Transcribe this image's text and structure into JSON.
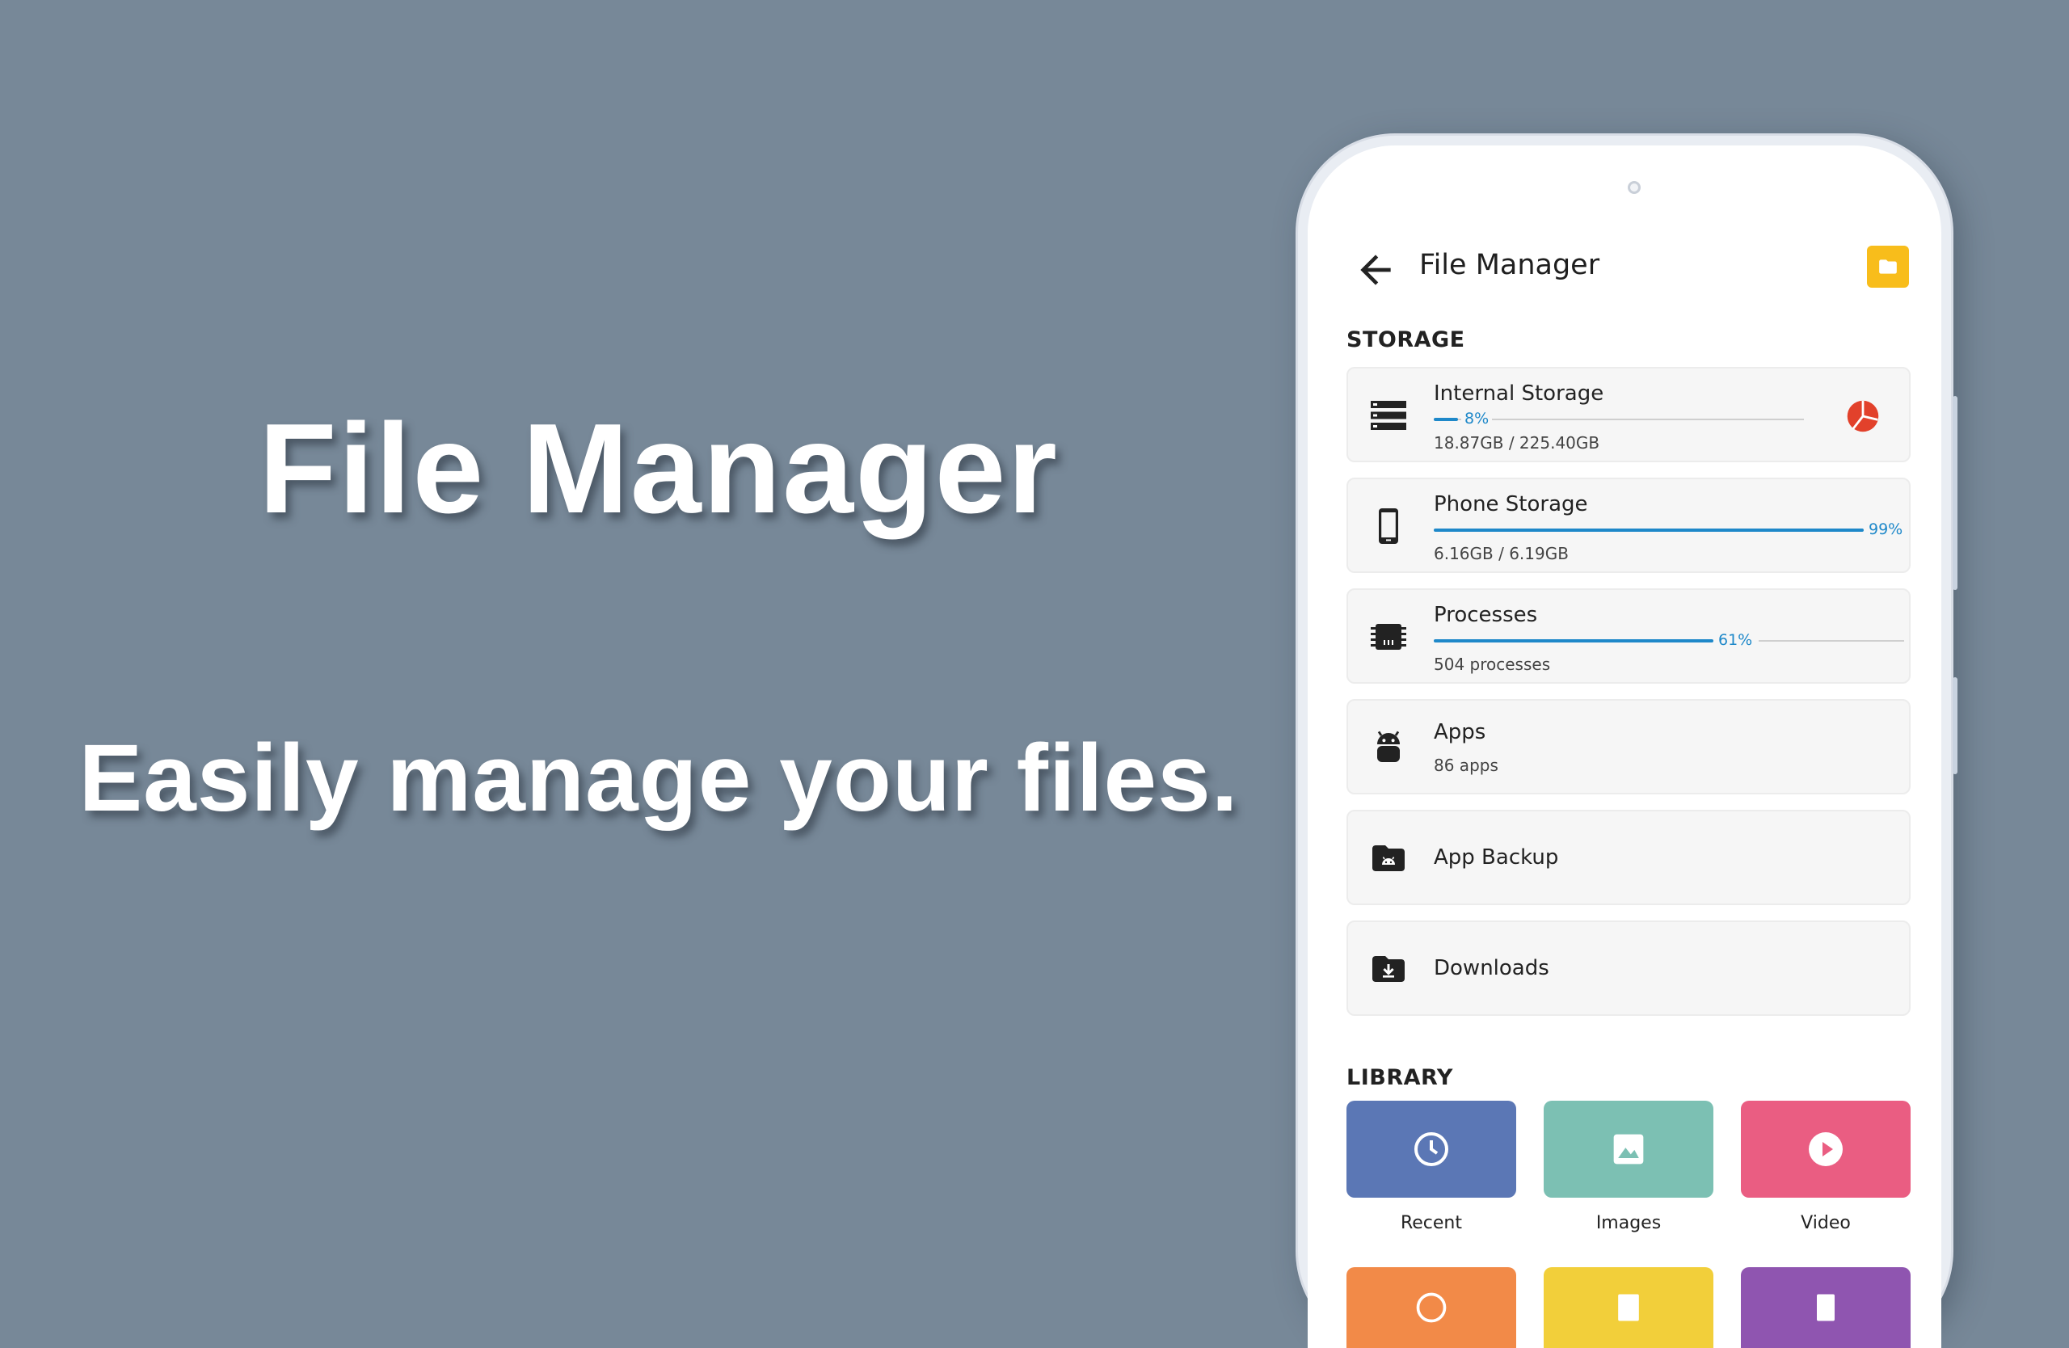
{
  "promo": {
    "title": "File Manager",
    "subtitle": "Easily manage your files."
  },
  "app_bar": {
    "title": "File Manager",
    "back_icon": "arrow-back-icon",
    "action_icon": "folder-icon",
    "action_color": "#f8bd1b"
  },
  "storage": {
    "label": "STORAGE",
    "items": [
      {
        "name": "Internal Storage",
        "sub": "18.87GB / 225.40GB",
        "percent_label": "8%",
        "percent": 8,
        "icon": "storage-server-icon",
        "trailing_icon": "pie-chart-icon"
      },
      {
        "name": "Phone Storage",
        "sub": "6.16GB / 6.19GB",
        "percent_label": "99%",
        "percent": 99,
        "icon": "phone-icon"
      },
      {
        "name": "Processes",
        "sub": "504 processes",
        "percent_label": "61%",
        "percent": 61,
        "icon": "cpu-chip-icon"
      },
      {
        "name": "Apps",
        "sub": "86 apps",
        "icon": "android-icon"
      },
      {
        "name": "App Backup",
        "icon": "folder-android-icon"
      },
      {
        "name": "Downloads",
        "icon": "folder-download-icon"
      }
    ]
  },
  "library": {
    "label": "LIBRARY",
    "tiles": [
      {
        "label": "Recent",
        "icon": "clock-icon",
        "color": "#5b77b5"
      },
      {
        "label": "Images",
        "icon": "image-icon",
        "color": "#7cc0b3"
      },
      {
        "label": "Video",
        "icon": "play-icon",
        "color": "#ea5d82"
      },
      {
        "label": "",
        "icon": "music-icon",
        "color": "#f28a48"
      },
      {
        "label": "",
        "icon": "document-icon",
        "color": "#f2cf3a"
      },
      {
        "label": "",
        "icon": "archive-icon",
        "color": "#8f55b0"
      }
    ]
  },
  "colors": {
    "background": "#778898",
    "accent": "#1e88c9",
    "pie_red": "#e2412b"
  }
}
